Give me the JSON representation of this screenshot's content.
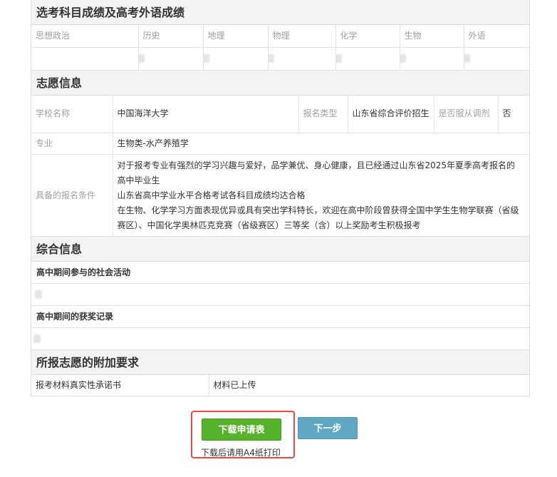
{
  "elective_section": {
    "title": "选考科目成绩及高考外语成绩",
    "subjects": [
      "思想政治",
      "历史",
      "地理",
      "物理",
      "化学",
      "生物",
      "外语"
    ]
  },
  "aspiration_section": {
    "title": "志愿信息",
    "school_label": "学校名称",
    "school_value": "中国海洋大学",
    "apply_type_label": "报名类型",
    "apply_type_value": "山东省综合评价招生",
    "adjust_label": "是否服从调剂",
    "adjust_value": "否",
    "major_label": "专业",
    "major_value": "生物类-水产养殖学",
    "condition_label": "具备的报名条件",
    "conditions": [
      "对于报考专业有强烈的学习兴趣与爱好，品学兼优、身心健康，且已经通过山东省2025年夏季高考报名的高中毕业生",
      "山东省高中学业水平合格考试各科目成绩均达合格",
      "在生物、化学学习方面表现优异或具有突出学科特长，欢迎在高中阶段曾获得全国中学生生物学联赛（省级赛区）、中国化学奥林匹克竞赛（省级赛区）三等奖（含）以上奖励考生积极报考"
    ]
  },
  "comprehensive_section": {
    "title": "综合信息",
    "social_activities_label": "高中期间参与的社会活动",
    "awards_label": "高中期间的获奖记录"
  },
  "additional_section": {
    "title": "所报志愿的附加要求",
    "pledge_label": "报考材料真实性承诺书",
    "pledge_status": "材料已上传"
  },
  "actions": {
    "download_label": "下载申请表",
    "next_label": "下一步",
    "print_hint": "下载后请用A4纸打印"
  },
  "colors": {
    "download_button": "#57b22b",
    "next_button": "#60a7c3",
    "highlight_border": "#e74a44"
  }
}
